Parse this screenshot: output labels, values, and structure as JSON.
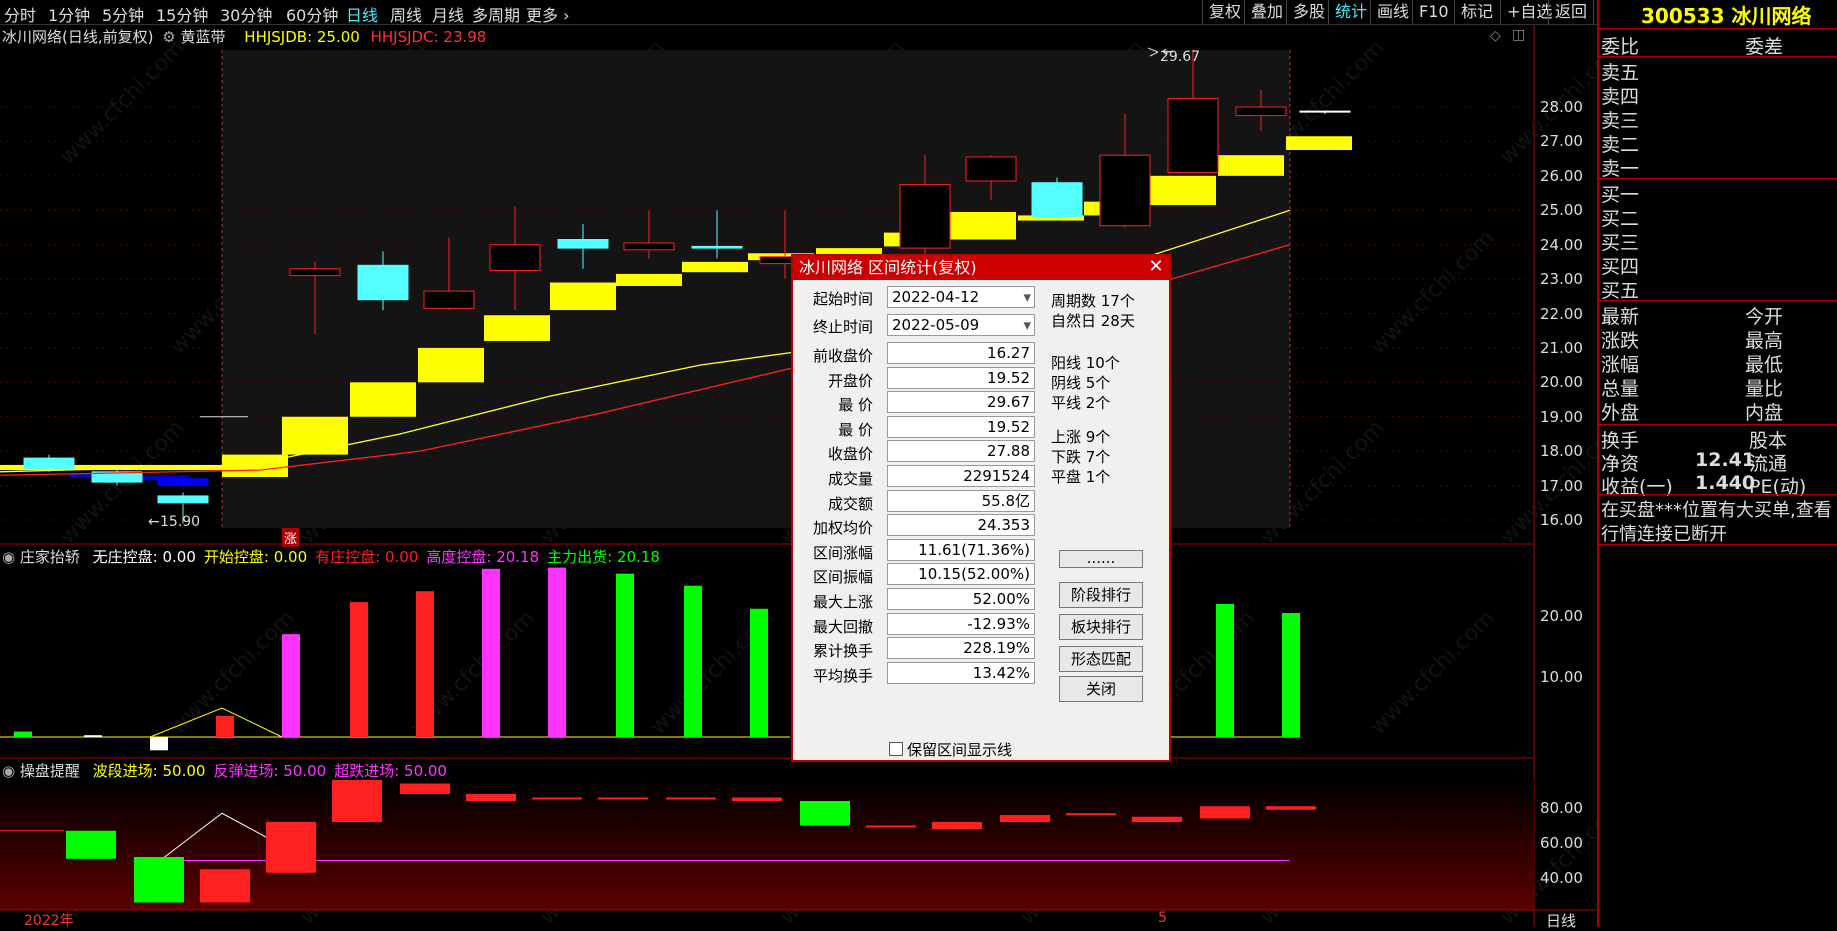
{
  "toolbar": {
    "periods": [
      "分时",
      "1分钟",
      "5分钟",
      "15分钟",
      "30分钟",
      "60分钟",
      "日线",
      "周线",
      "月线",
      "多周期",
      "更多"
    ],
    "active_period": "日线",
    "right_items": [
      "复权",
      "叠加",
      "多股",
      "统计",
      "画线",
      "F10",
      "标记",
      "+自选",
      "返回"
    ],
    "active_right": "统计"
  },
  "main_chart": {
    "title": "冰川网络(日线,前复权)",
    "indicator": "黄蓝带",
    "ind1": "HHJSJDB: 25.00",
    "ind2": "HHJSJDC: 23.98",
    "high_label": "29.67",
    "low_label": "15.90",
    "zhang_mark": "涨",
    "y_ticks": [
      "28.00",
      "27.00",
      "26.00",
      "25.00",
      "24.00",
      "23.00",
      "22.00",
      "21.00",
      "20.00",
      "19.00",
      "18.00",
      "17.00",
      "16.00"
    ]
  },
  "sub1": {
    "title": "庄家抬轿",
    "items": [
      {
        "text": "无庄控盘: 0.00",
        "color": "#ffffff"
      },
      {
        "text": "开始控盘: 0.00",
        "color": "#ffff00"
      },
      {
        "text": "有庄控盘: 0.00",
        "color": "#ff2020"
      },
      {
        "text": "高度控盘: 20.18",
        "color": "#ff33ff"
      },
      {
        "text": "主力出货: 20.18",
        "color": "#00ff00"
      }
    ],
    "y_ticks": [
      "20.00",
      "10.00"
    ]
  },
  "sub2": {
    "title": "操盘提醒",
    "items": [
      {
        "text": "波段进场: 50.00",
        "color": "#ffff00"
      },
      {
        "text": "反弹进场: 50.00",
        "color": "#ff33ff"
      },
      {
        "text": "超跌进场: 50.00",
        "color": "#ff33ff"
      }
    ],
    "y_ticks": [
      "80.00",
      "60.00",
      "40.00"
    ]
  },
  "xaxis": {
    "year": "2022年",
    "month": "5",
    "period": "日线"
  },
  "right_panel": {
    "code_name": "300533 冰川网络",
    "row1": [
      "委比",
      "委差"
    ],
    "sell": [
      "卖五",
      "卖四",
      "卖三",
      "卖二",
      "卖一"
    ],
    "buy": [
      "买一",
      "买二",
      "买三",
      "买四",
      "买五"
    ],
    "quote_left": [
      "最新",
      "涨跌",
      "涨幅",
      "总量",
      "外盘"
    ],
    "quote_right": [
      "今开",
      "最高",
      "最低",
      "量比",
      "内盘"
    ],
    "misc": [
      {
        "l": "换手",
        "v": "",
        "r": "股本"
      },
      {
        "l": "净资",
        "v": "12.41",
        "r": "流通"
      },
      {
        "l": "收益(一)",
        "v": "1.440",
        "r": "PE(动)"
      }
    ],
    "msg1": "在买盘***位置有大买单,查看",
    "msg2": "行情连接已断开"
  },
  "dialog": {
    "title": "冰川网络 区间统计(复权)",
    "start_label": "起始时间",
    "start": "2022-04-12",
    "end_label": "终止时间",
    "end": "2022-05-09",
    "rows": [
      {
        "label": "前收盘价",
        "value": "16.27"
      },
      {
        "label": "开盘价",
        "value": "19.52"
      },
      {
        "label": "最 价",
        "value": "29.67"
      },
      {
        "label": "最 价",
        "value": "19.52"
      },
      {
        "label": "收盘价",
        "value": "27.88"
      },
      {
        "label": "成交量",
        "value": "2291524"
      },
      {
        "label": "成交额",
        "value": "55.8亿"
      },
      {
        "label": "加权均价",
        "value": "24.353"
      },
      {
        "label": "区间涨幅",
        "value": "11.61(71.36%)"
      },
      {
        "label": "区间振幅",
        "value": "10.15(52.00%)"
      },
      {
        "label": "最大上涨",
        "value": "52.00%"
      },
      {
        "label": "最大回撤",
        "value": "-12.93%"
      },
      {
        "label": "累计换手",
        "value": "228.19%"
      },
      {
        "label": "平均换手",
        "value": "13.42%"
      }
    ],
    "stats": [
      "周期数 17个",
      "自然日 28天",
      "阳线 10个",
      "阴线 5个",
      "平线 2个",
      "上涨 9个",
      "下跌 7个",
      "平盘 1个"
    ],
    "buttons": [
      "......",
      "阶段排行",
      "板块排行",
      "形态匹配",
      "关闭"
    ],
    "checkbox_label": "保留区间显示线"
  },
  "watermark": "www.cfchi.com"
}
